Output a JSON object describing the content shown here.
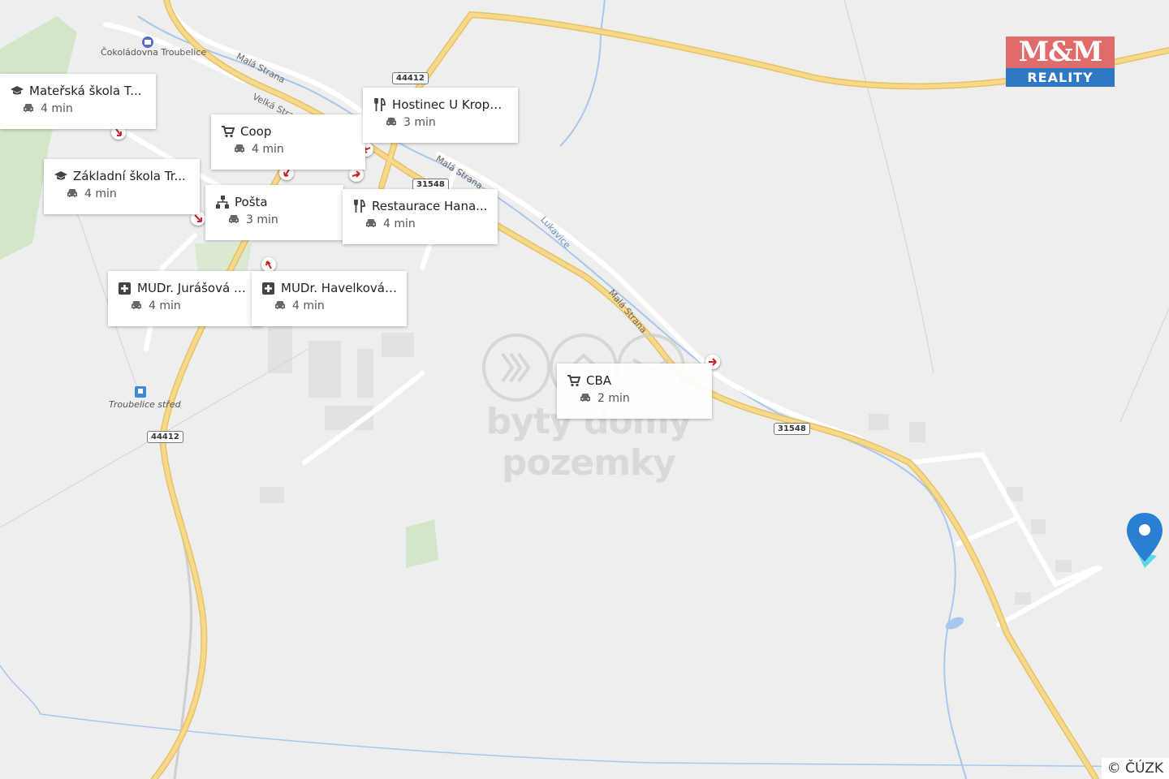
{
  "map": {
    "brand": "M&M REALITY",
    "brand_top": "M&M",
    "brand_bottom": "REALITY",
    "watermark": "byty domy pozemky",
    "copyright": "© ČÚZK",
    "place_labels": {
      "chocolate": "Čokoládovna Troubelice",
      "station": "Troubelice střed"
    },
    "road_labels": {
      "mala_strana_1": "Malá Strana",
      "velka_strana": "Velká Strana",
      "mala_strana_2": "Malá Strana",
      "mala_strana_3": "Malá Strana",
      "lukavice": "Lukavice"
    },
    "shields": {
      "r44412_a": "44412",
      "r44412_b": "44412",
      "r31548_a": "31548",
      "r31548_b": "31548"
    },
    "pois": [
      {
        "name": "Mateřská škola T...",
        "time": "4 min",
        "icon": "school-icon"
      },
      {
        "name": "Coop",
        "time": "4 min",
        "icon": "cart-icon"
      },
      {
        "name": "Hostinec U Kropá...",
        "time": "3 min",
        "icon": "restaurant-icon"
      },
      {
        "name": "Základní škola Tr...",
        "time": "4 min",
        "icon": "school-icon"
      },
      {
        "name": "Pošta",
        "time": "3 min",
        "icon": "post-icon"
      },
      {
        "name": "Restaurace Hana...",
        "time": "4 min",
        "icon": "restaurant-icon"
      },
      {
        "name": "MUDr. Jurášová A...",
        "time": "4 min",
        "icon": "medical-icon"
      },
      {
        "name": "MUDr. Havelková ...",
        "time": "4 min",
        "icon": "medical-icon"
      },
      {
        "name": "CBA",
        "time": "2 min",
        "icon": "cart-icon"
      }
    ],
    "colors": {
      "background": "#eeeeee",
      "major_road": "#f6d98a",
      "minor_road": "#ffffff",
      "water": "#a9c7ee",
      "park": "#cfe3c4",
      "marker_arrow": "#cc2222",
      "location_pin": "#2a7fd4"
    }
  }
}
